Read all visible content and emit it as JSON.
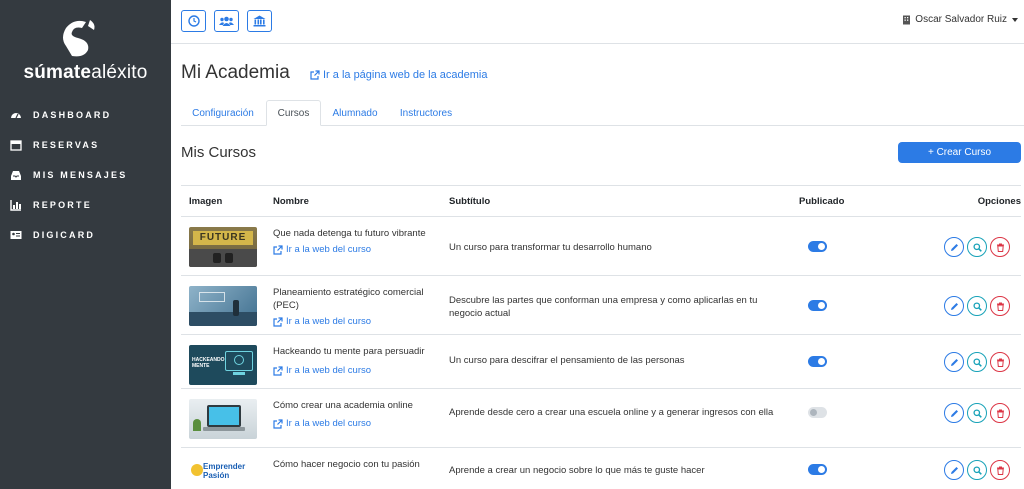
{
  "brand": {
    "logo_text_bold": "súmate",
    "logo_text_thin": "aléxito"
  },
  "sidebar": {
    "items": [
      {
        "label": "DASHBOARD",
        "icon": "dashboard-icon"
      },
      {
        "label": "RESERVAS",
        "icon": "calendar-icon"
      },
      {
        "label": "MIS MENSAJES",
        "icon": "inbox-icon"
      },
      {
        "label": "REPORTE",
        "icon": "chart-icon"
      },
      {
        "label": "DIGICARD",
        "icon": "id-card-icon"
      }
    ]
  },
  "topbar": {
    "buttons": [
      "clock-icon",
      "users-icon",
      "institution-icon"
    ],
    "user_name": "Oscar Salvador Ruiz"
  },
  "page": {
    "title": "Mi Academia",
    "academy_link": "Ir a la página web de la academia",
    "tabs": [
      {
        "label": "Configuración",
        "active": false
      },
      {
        "label": "Cursos",
        "active": true
      },
      {
        "label": "Alumnado",
        "active": false
      },
      {
        "label": "Instructores",
        "active": false
      }
    ],
    "section_title": "Mis Cursos",
    "create_button": "+ Crear Curso"
  },
  "table": {
    "headers": {
      "image": "Imagen",
      "name": "Nombre",
      "subtitle": "Subtítulo",
      "published": "Publicado",
      "options": "Opciones"
    },
    "link_label": "Ir a la web del curso",
    "rows": [
      {
        "name": "Que nada detenga tu futuro vibrante",
        "subtitle": "Un curso para transformar tu desarrollo humano",
        "published": true,
        "thumb_text": "FUTURE"
      },
      {
        "name": "Planeamiento estratégico comercial (PEC)",
        "subtitle": "Descubre las partes que conforman una empresa y como aplicarlas en tu negocio actual",
        "published": true,
        "thumb_text": ""
      },
      {
        "name": "Hackeando tu mente para persuadir",
        "subtitle": "Un curso para descifrar el pensamiento de las personas",
        "published": true,
        "thumb_text": "HACKEANDO MENTE"
      },
      {
        "name": "Cómo crear una academia online",
        "subtitle": "Aprende desde cero a crear una escuela online y a generar ingresos con ella",
        "published": false,
        "thumb_text": ""
      },
      {
        "name": "Cómo hacer negocio con tu pasión",
        "subtitle": "Aprende a crear un negocio sobre lo que más te guste hacer",
        "published": true,
        "thumb_text": "Emprender Pasión"
      }
    ]
  },
  "colors": {
    "sidebar": "#343a40",
    "accent": "#2c7be5",
    "info": "#17a2b8",
    "danger": "#dc3545"
  }
}
